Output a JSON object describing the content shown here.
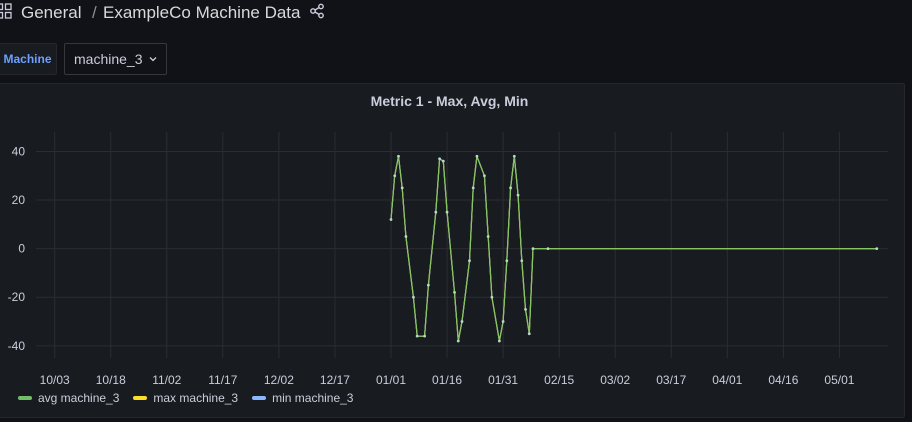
{
  "header": {
    "folder": "General",
    "separator": "/",
    "title": "ExampleCo Machine Data"
  },
  "variables": {
    "label": "Machine",
    "value": "machine_3"
  },
  "panel": {
    "title": "Metric 1 - Max, Avg, Min"
  },
  "chart_data": {
    "type": "line",
    "title": "Metric 1 - Max, Avg, Min",
    "xlabel": "",
    "ylabel": "",
    "x_tick_labels": [
      "10/03",
      "10/18",
      "11/02",
      "11/17",
      "12/02",
      "12/17",
      "01/01",
      "01/16",
      "01/31",
      "02/15",
      "03/02",
      "03/17",
      "04/01",
      "04/16",
      "05/01"
    ],
    "y_ticks": [
      40,
      20,
      0,
      -20,
      -40
    ],
    "ylim": [
      -45,
      48
    ],
    "xlim": [
      "09/28",
      "05/14"
    ],
    "grid": true,
    "legend": "bottom-left",
    "series": [
      {
        "name": "avg machine_3",
        "color": "#73bf69"
      },
      {
        "name": "max machine_3",
        "color": "#fade2a"
      },
      {
        "name": "min machine_3",
        "color": "#8ab8ff"
      }
    ],
    "x": [
      "01/01",
      "01/02",
      "01/03",
      "01/04",
      "01/05",
      "01/07",
      "01/08",
      "01/10",
      "01/11",
      "01/13",
      "01/14",
      "01/15",
      "01/16",
      "01/18",
      "01/19",
      "01/20",
      "01/22",
      "01/23",
      "01/24",
      "01/26",
      "01/27",
      "01/28",
      "01/30",
      "01/31",
      "02/01",
      "02/02",
      "02/03",
      "02/04",
      "02/05",
      "02/06",
      "02/07",
      "02/08",
      "02/12",
      "05/11"
    ],
    "values": [
      12,
      30,
      38,
      25,
      5,
      -20,
      -36,
      -36,
      -15,
      15,
      37,
      36,
      15,
      -18,
      -38,
      -30,
      -5,
      25,
      38,
      30,
      5,
      -20,
      -38,
      -30,
      -5,
      25,
      38,
      22,
      -5,
      -25,
      -35,
      0,
      0,
      0
    ]
  }
}
